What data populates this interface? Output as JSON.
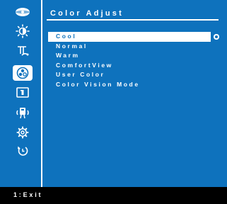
{
  "osd": {
    "title": "Color Adjust",
    "menu_items": [
      {
        "label": "Cool",
        "selected": true
      },
      {
        "label": "Normal",
        "selected": false
      },
      {
        "label": "Warm",
        "selected": false
      },
      {
        "label": "ComfortView",
        "selected": false
      },
      {
        "label": "User Color",
        "selected": false
      },
      {
        "label": "Color Vision Mode",
        "selected": false
      }
    ]
  },
  "sidebar": {
    "icons": [
      {
        "name": "input-source-icon"
      },
      {
        "name": "brightness-contrast-icon"
      },
      {
        "name": "auto-adjust-icon"
      },
      {
        "name": "color-icon",
        "selected": true
      },
      {
        "name": "display-icon"
      },
      {
        "name": "audio-icon"
      },
      {
        "name": "settings-icon"
      },
      {
        "name": "reset-icon"
      }
    ]
  },
  "footer": {
    "hint": "1:Exit"
  },
  "colors": {
    "background": "#0e72bd",
    "foreground": "#ffffff",
    "footer": "#000000"
  }
}
